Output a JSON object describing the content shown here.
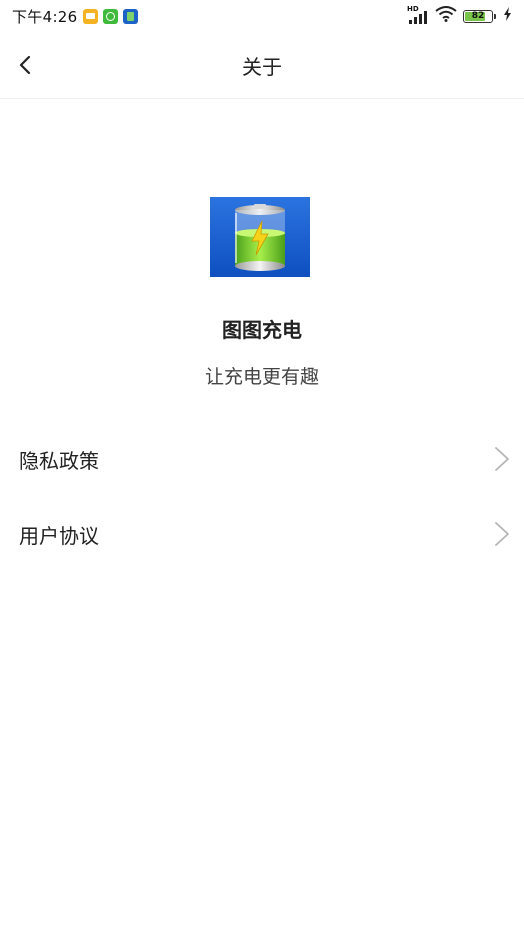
{
  "status_bar": {
    "time": "下午4:26",
    "network_label": "HD",
    "battery_level": "82",
    "battery_fraction": 0.82
  },
  "nav": {
    "title": "关于",
    "back_icon": "chevron-left-icon"
  },
  "app": {
    "name": "图图充电",
    "slogan": "让充电更有趣",
    "logo_icon": "battery-charging-icon"
  },
  "menu": {
    "items": [
      {
        "label": "隐私政策",
        "icon": "chevron-right-icon"
      },
      {
        "label": "用户协议",
        "icon": "chevron-right-icon"
      }
    ]
  },
  "colors": {
    "logo_background": "#1a5fd0",
    "battery_green": "#7ed23c",
    "chevron": "#b5b5b5"
  }
}
